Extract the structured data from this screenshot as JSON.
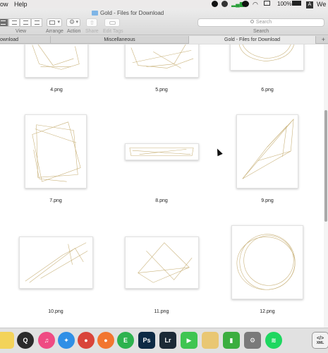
{
  "menubar": {
    "left_items": [
      "ow",
      "Help"
    ],
    "battery": "100%",
    "right_clip": "We"
  },
  "toolbar": {
    "window_title": "Gold - Files for Download",
    "view_label": "View",
    "arrange_label": "Arrange",
    "action_label": "Action",
    "share_label": "Share",
    "edit_tags_label": "Edit Tags",
    "search_placeholder": "Search",
    "search_label": "Search"
  },
  "tabs": [
    {
      "label": "ownload",
      "active": false
    },
    {
      "label": "Miscellaneous",
      "active": false
    },
    {
      "label": "Gold - Files for Download",
      "active": true
    }
  ],
  "files": [
    {
      "name": "4.png"
    },
    {
      "name": "5.png"
    },
    {
      "name": "6.png"
    },
    {
      "name": "7.png"
    },
    {
      "name": "8.png"
    },
    {
      "name": "9.png"
    },
    {
      "name": "10.png"
    },
    {
      "name": "11.png"
    },
    {
      "name": "12.png"
    }
  ],
  "dock": {
    "apps": [
      {
        "name": "notes-app",
        "icon": "notes-icon",
        "color": "#f3d35a",
        "glyph": ""
      },
      {
        "name": "quicktime-app",
        "icon": "quicktime-icon",
        "color": "#2b2b2b",
        "glyph": "Q"
      },
      {
        "name": "itunes-app",
        "icon": "music-icon",
        "color": "#ef4b83",
        "glyph": "♫"
      },
      {
        "name": "safari-app",
        "icon": "compass-icon",
        "color": "#2f8fe6",
        "glyph": "✦"
      },
      {
        "name": "chrome-app",
        "icon": "chrome-icon",
        "color": "#d9443a",
        "glyph": "●"
      },
      {
        "name": "firefox-app",
        "icon": "firefox-icon",
        "color": "#f2762f",
        "glyph": "●"
      },
      {
        "name": "evernote-app",
        "icon": "evernote-icon",
        "color": "#2db24e",
        "glyph": "E"
      },
      {
        "name": "photoshop-app",
        "icon": "photoshop-icon",
        "color": "#0d2a44",
        "glyph": "Ps"
      },
      {
        "name": "lightroom-app",
        "icon": "lightroom-icon",
        "color": "#1c2a36",
        "glyph": "Lr"
      },
      {
        "name": "facetime-app",
        "icon": "camera-icon",
        "color": "#3fc551",
        "glyph": "▶"
      },
      {
        "name": "script-app",
        "icon": "script-icon",
        "color": "#e9c773",
        "glyph": ""
      },
      {
        "name": "numbers-app",
        "icon": "bar-chart-icon",
        "color": "#3cae3f",
        "glyph": "▮"
      },
      {
        "name": "preferences-app",
        "icon": "gear-icon",
        "color": "#7a7a7a",
        "glyph": "⚙"
      },
      {
        "name": "spotify-app",
        "icon": "spotify-icon",
        "color": "#1ed760",
        "glyph": "≋"
      },
      {
        "name": "xml-editor-app",
        "icon": "xml-icon",
        "color": "#f2f2f2",
        "glyph": ""
      }
    ],
    "xml_glyph": "</>",
    "xml_caption": "XML"
  }
}
